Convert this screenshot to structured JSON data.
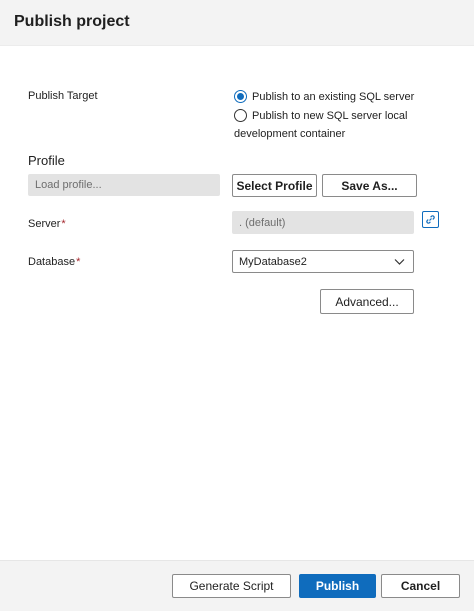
{
  "dialog": {
    "title": "Publish project"
  },
  "publish_target": {
    "label": "Publish Target",
    "options": [
      {
        "label": "Publish to an existing SQL server",
        "selected": true
      },
      {
        "label_line1": "Publish to new SQL server local",
        "label_line2": "development container",
        "selected": false
      }
    ]
  },
  "profile": {
    "title": "Profile",
    "placeholder": "Load profile...",
    "select_label": "Select Profile",
    "save_as_label": "Save As..."
  },
  "server": {
    "label": "Server",
    "required_mark": "*",
    "value": ". (default)"
  },
  "database": {
    "label": "Database",
    "required_mark": "*",
    "value": "MyDatabase2"
  },
  "advanced": {
    "label": "Advanced..."
  },
  "footer": {
    "generate_label": "Generate Script",
    "publish_label": "Publish",
    "cancel_label": "Cancel"
  },
  "colors": {
    "accent": "#0f6cbd",
    "required": "#a4262c"
  }
}
